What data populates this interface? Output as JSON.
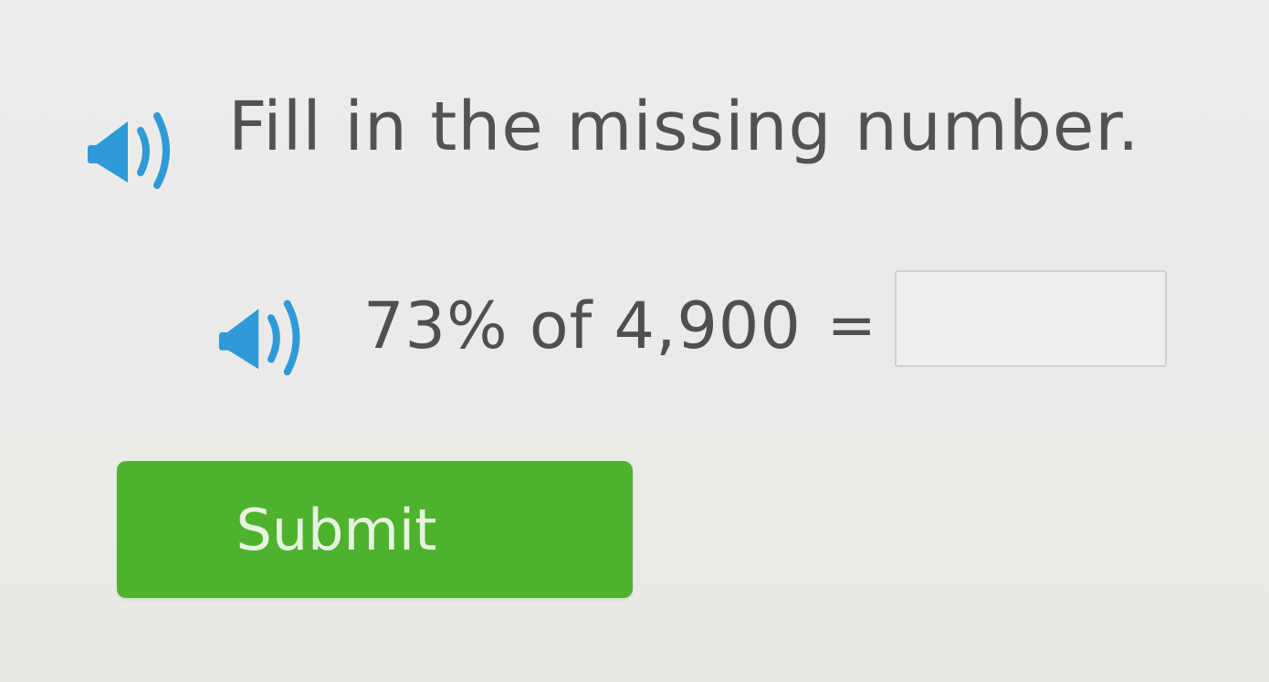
{
  "question": {
    "instruction": "Fill in the missing number.",
    "expression": "73% of 4,900",
    "equals_sign": "=",
    "answer_value": "",
    "answer_placeholder": ""
  },
  "submit": {
    "label": "Submit"
  },
  "colors": {
    "speaker_icon": "#2e9ad8",
    "submit_bg": "#4db32c",
    "text": "#525252"
  },
  "icons": {
    "instruction_audio": "speaker-icon",
    "expression_audio": "speaker-icon"
  }
}
